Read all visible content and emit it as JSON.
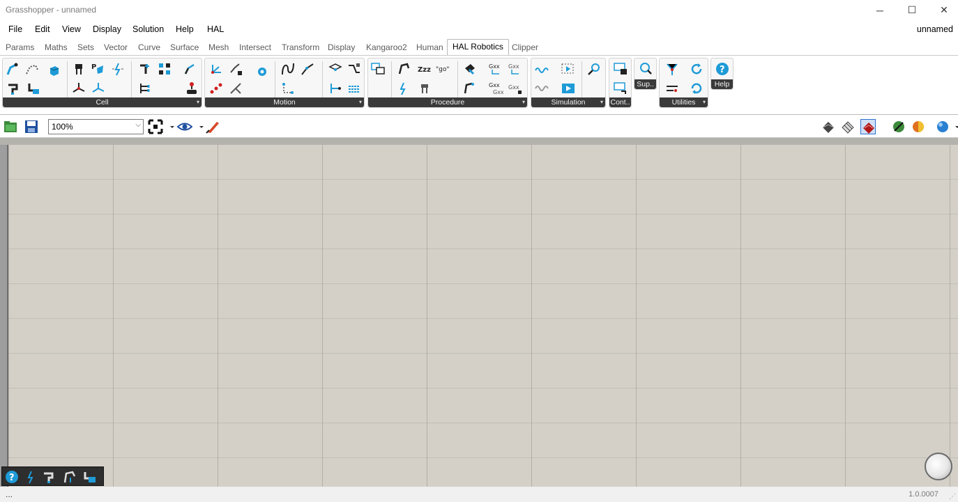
{
  "window": {
    "title": "Grasshopper - unnamed",
    "minimize_glyph": "─",
    "maximize_glyph": "☐",
    "close_glyph": "✕"
  },
  "menu": {
    "items": [
      "File",
      "Edit",
      "View",
      "Display",
      "Solution",
      "Help",
      "HAL"
    ],
    "document_name": "unnamed"
  },
  "tabs": {
    "items": [
      "Params",
      "Maths",
      "Sets",
      "Vector",
      "Curve",
      "Surface",
      "Mesh",
      "Intersect",
      "Transform",
      "Display",
      "Kangaroo2",
      "Human",
      "HAL Robotics",
      "Clipper"
    ],
    "active": "HAL Robotics"
  },
  "ribbon": {
    "groups": [
      "Cell",
      "Motion",
      "Procedure",
      "Simulation",
      "Cont..",
      "Sup..",
      "Utilities",
      "Help"
    ],
    "expander_glyph": "▾"
  },
  "toolbar": {
    "zoom_value": "100%",
    "zoom_arrow": "⌵"
  },
  "status": {
    "left_text": "...",
    "version": "1.0.0007"
  },
  "colors": {
    "canvas_bg": "#d4d0c8",
    "grid_line": "#aaa8a0",
    "icon_blue": "#1e9bd7",
    "ribbon_label_bg": "#3a3a3a"
  }
}
